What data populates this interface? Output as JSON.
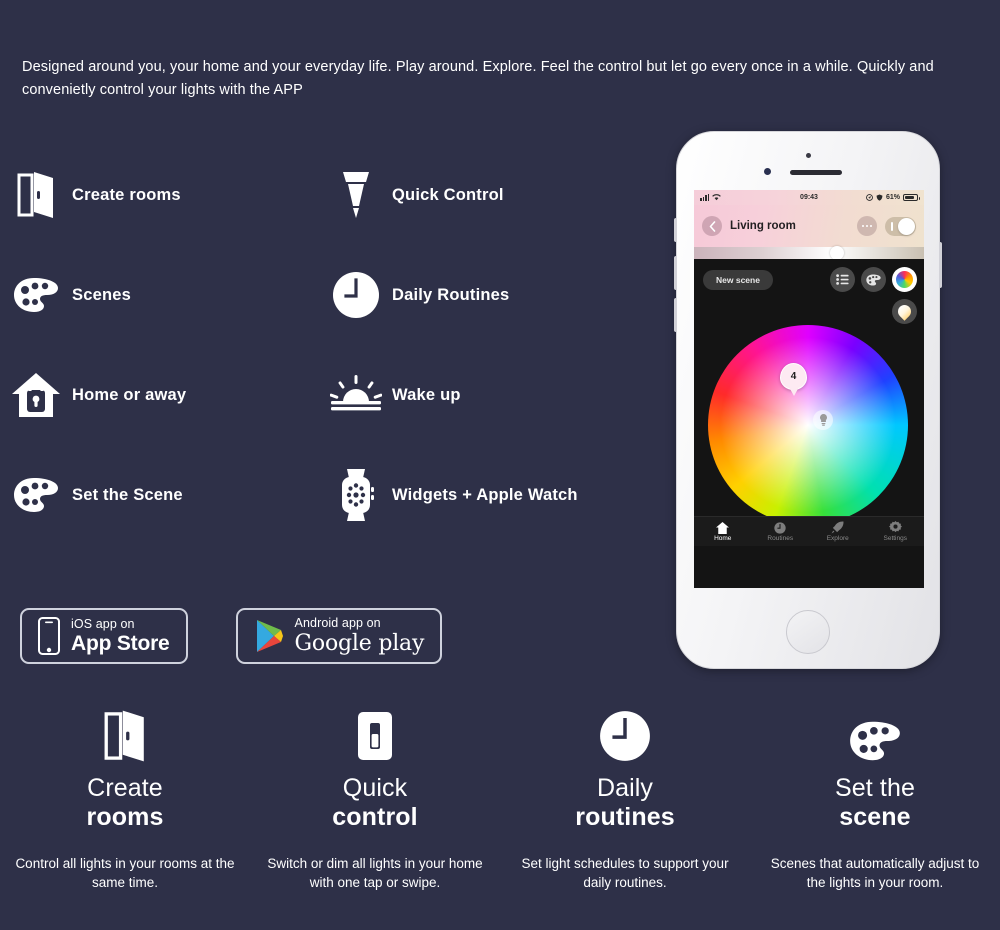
{
  "intro": {
    "text": "Designed around you, your home and your everyday life. Play around. Explore. Feel the control but let go every once in a while. Quickly and convenietly control your lights with the  APP"
  },
  "features": [
    {
      "label": "Create rooms",
      "icon": "door-icon"
    },
    {
      "label": "Quick Control",
      "icon": "bulb-spot-icon"
    },
    {
      "label": "Scenes",
      "icon": "palette-icon"
    },
    {
      "label": "Daily Routines",
      "icon": "clock-icon"
    },
    {
      "label": "Home or away",
      "icon": "house-lock-icon"
    },
    {
      "label": "Wake up",
      "icon": "sunrise-icon"
    },
    {
      "label": "Set the Scene",
      "icon": "palette-icon"
    },
    {
      "label": "Widgets + Apple Watch",
      "icon": "apple-watch-icon"
    }
  ],
  "badges": {
    "ios": {
      "small": "iOS app on",
      "big": "App Store",
      "icon": "iphone-icon"
    },
    "android": {
      "small": "Android app on",
      "big": "Google play",
      "icon": "google-play-icon"
    }
  },
  "cards": [
    {
      "icon": "door-icon",
      "title1": "Create",
      "title2": "rooms",
      "desc": "Control all lights in your rooms at the same time."
    },
    {
      "icon": "light-switch-icon",
      "title1": "Quick",
      "title2": "control",
      "desc": "Switch or dim all lights in your home with one tap or swipe."
    },
    {
      "icon": "clock-icon",
      "title1": "Daily",
      "title2": "routines",
      "desc": "Set light schedules to support your daily routines."
    },
    {
      "icon": "palette-icon",
      "title1": "Set the",
      "title2": "scene",
      "desc": "Scenes that automatically adjust to the lights in your room."
    }
  ],
  "phone": {
    "status_bar": {
      "time": "09:43",
      "battery": "61%"
    },
    "room": {
      "name": "Living room"
    },
    "scene_button": {
      "label": "New scene"
    },
    "color_wheel": {
      "pin_label": "4"
    },
    "tabs": [
      {
        "label": "Home",
        "icon": "home-icon",
        "active": true
      },
      {
        "label": "Routines",
        "icon": "clock-icon",
        "active": false
      },
      {
        "label": "Explore",
        "icon": "rocket-icon",
        "active": false
      },
      {
        "label": "Settings",
        "icon": "gear-icon",
        "active": false
      }
    ]
  },
  "colors": {
    "background": "#2e3048",
    "text": "#ffffff",
    "phone_header_pink": "#f6c9d8",
    "app_dark": "#141414"
  }
}
